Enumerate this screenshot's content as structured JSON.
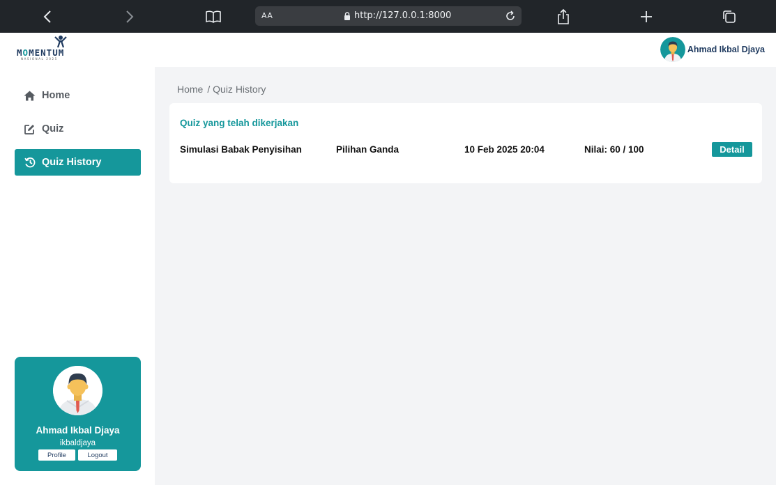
{
  "browser": {
    "url": "http://127.0.0.1:8000",
    "text_size_label": "AA"
  },
  "header": {
    "logo_text": "MOMENTUM",
    "logo_subtext": "NASIONAL 2025",
    "user_name": "Ahmad Ikbal Djaya"
  },
  "sidebar": {
    "items": [
      {
        "label": "Home",
        "icon": "home-icon",
        "active": false
      },
      {
        "label": "Quiz",
        "icon": "edit-icon",
        "active": false
      },
      {
        "label": "Quiz History",
        "icon": "history-icon",
        "active": true
      }
    ],
    "profile": {
      "name": "Ahmad Ikbal Djaya",
      "username": "ikbaldjaya",
      "profile_label": "Profile",
      "logout_label": "Logout"
    }
  },
  "breadcrumb": {
    "home": "Home",
    "current": "/ Quiz History"
  },
  "history": {
    "title": "Quiz yang telah dikerjakan",
    "rows": [
      {
        "quiz_name": "Simulasi Babak Penyisihan",
        "type": "Pilihan Ganda",
        "date": "10 Feb 2025 20:04",
        "score": "Nilai: 60 / 100",
        "action": "Detail"
      }
    ]
  },
  "colors": {
    "accent": "#15979b",
    "browser_bar": "#212529",
    "page_bg": "#f3f4f6",
    "navy": "#1f3a5f"
  }
}
